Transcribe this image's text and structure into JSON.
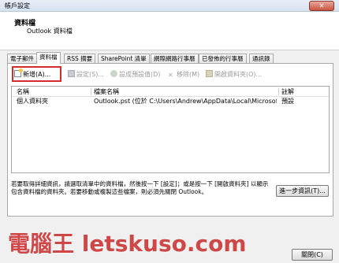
{
  "window": {
    "title": "帳戶設定",
    "close_label": "✕"
  },
  "header": {
    "title": "資料檔",
    "subtitle": "Outlook 資料檔"
  },
  "tabs": [
    {
      "label": "電子郵件",
      "active": false
    },
    {
      "label": "資料檔",
      "active": true
    },
    {
      "label": "RSS 摘要",
      "active": false
    },
    {
      "label": "SharePoint 清單",
      "active": false
    },
    {
      "label": "網際網路行事曆",
      "active": false
    },
    {
      "label": "已發佈的行事曆",
      "active": false
    },
    {
      "label": "通訊錄",
      "active": false
    }
  ],
  "toolbar": {
    "new_label": "新增(A)...",
    "settings_label": "設定(S)...",
    "set_default_label": "設成預設值(D)",
    "remove_label": "移除(M)",
    "open_folder_label": "開啟資料夾(O)..."
  },
  "list": {
    "columns": [
      "名稱",
      "檔案名稱",
      "註解"
    ],
    "rows": [
      {
        "name": "個人資料夾",
        "file": "Outlook.pst (位於 C:\\Users\\Andrew\\AppData\\Local\\Microsoft\\Outlo...",
        "comment": "預設"
      }
    ]
  },
  "info_text": "若要取得詳細資訊，請選取清單中的資料檔，然後按一下 [設定]；或是按一下 [開啟資料夾] 以顯示包含資料檔的資料夾。若要移動或複製這些檔案，則必須先關閉 Outlook。",
  "buttons": {
    "advanced": "進一步資訊(T)...",
    "close": "關閉(C)"
  },
  "watermark": "電腦王 letskuso.com"
}
